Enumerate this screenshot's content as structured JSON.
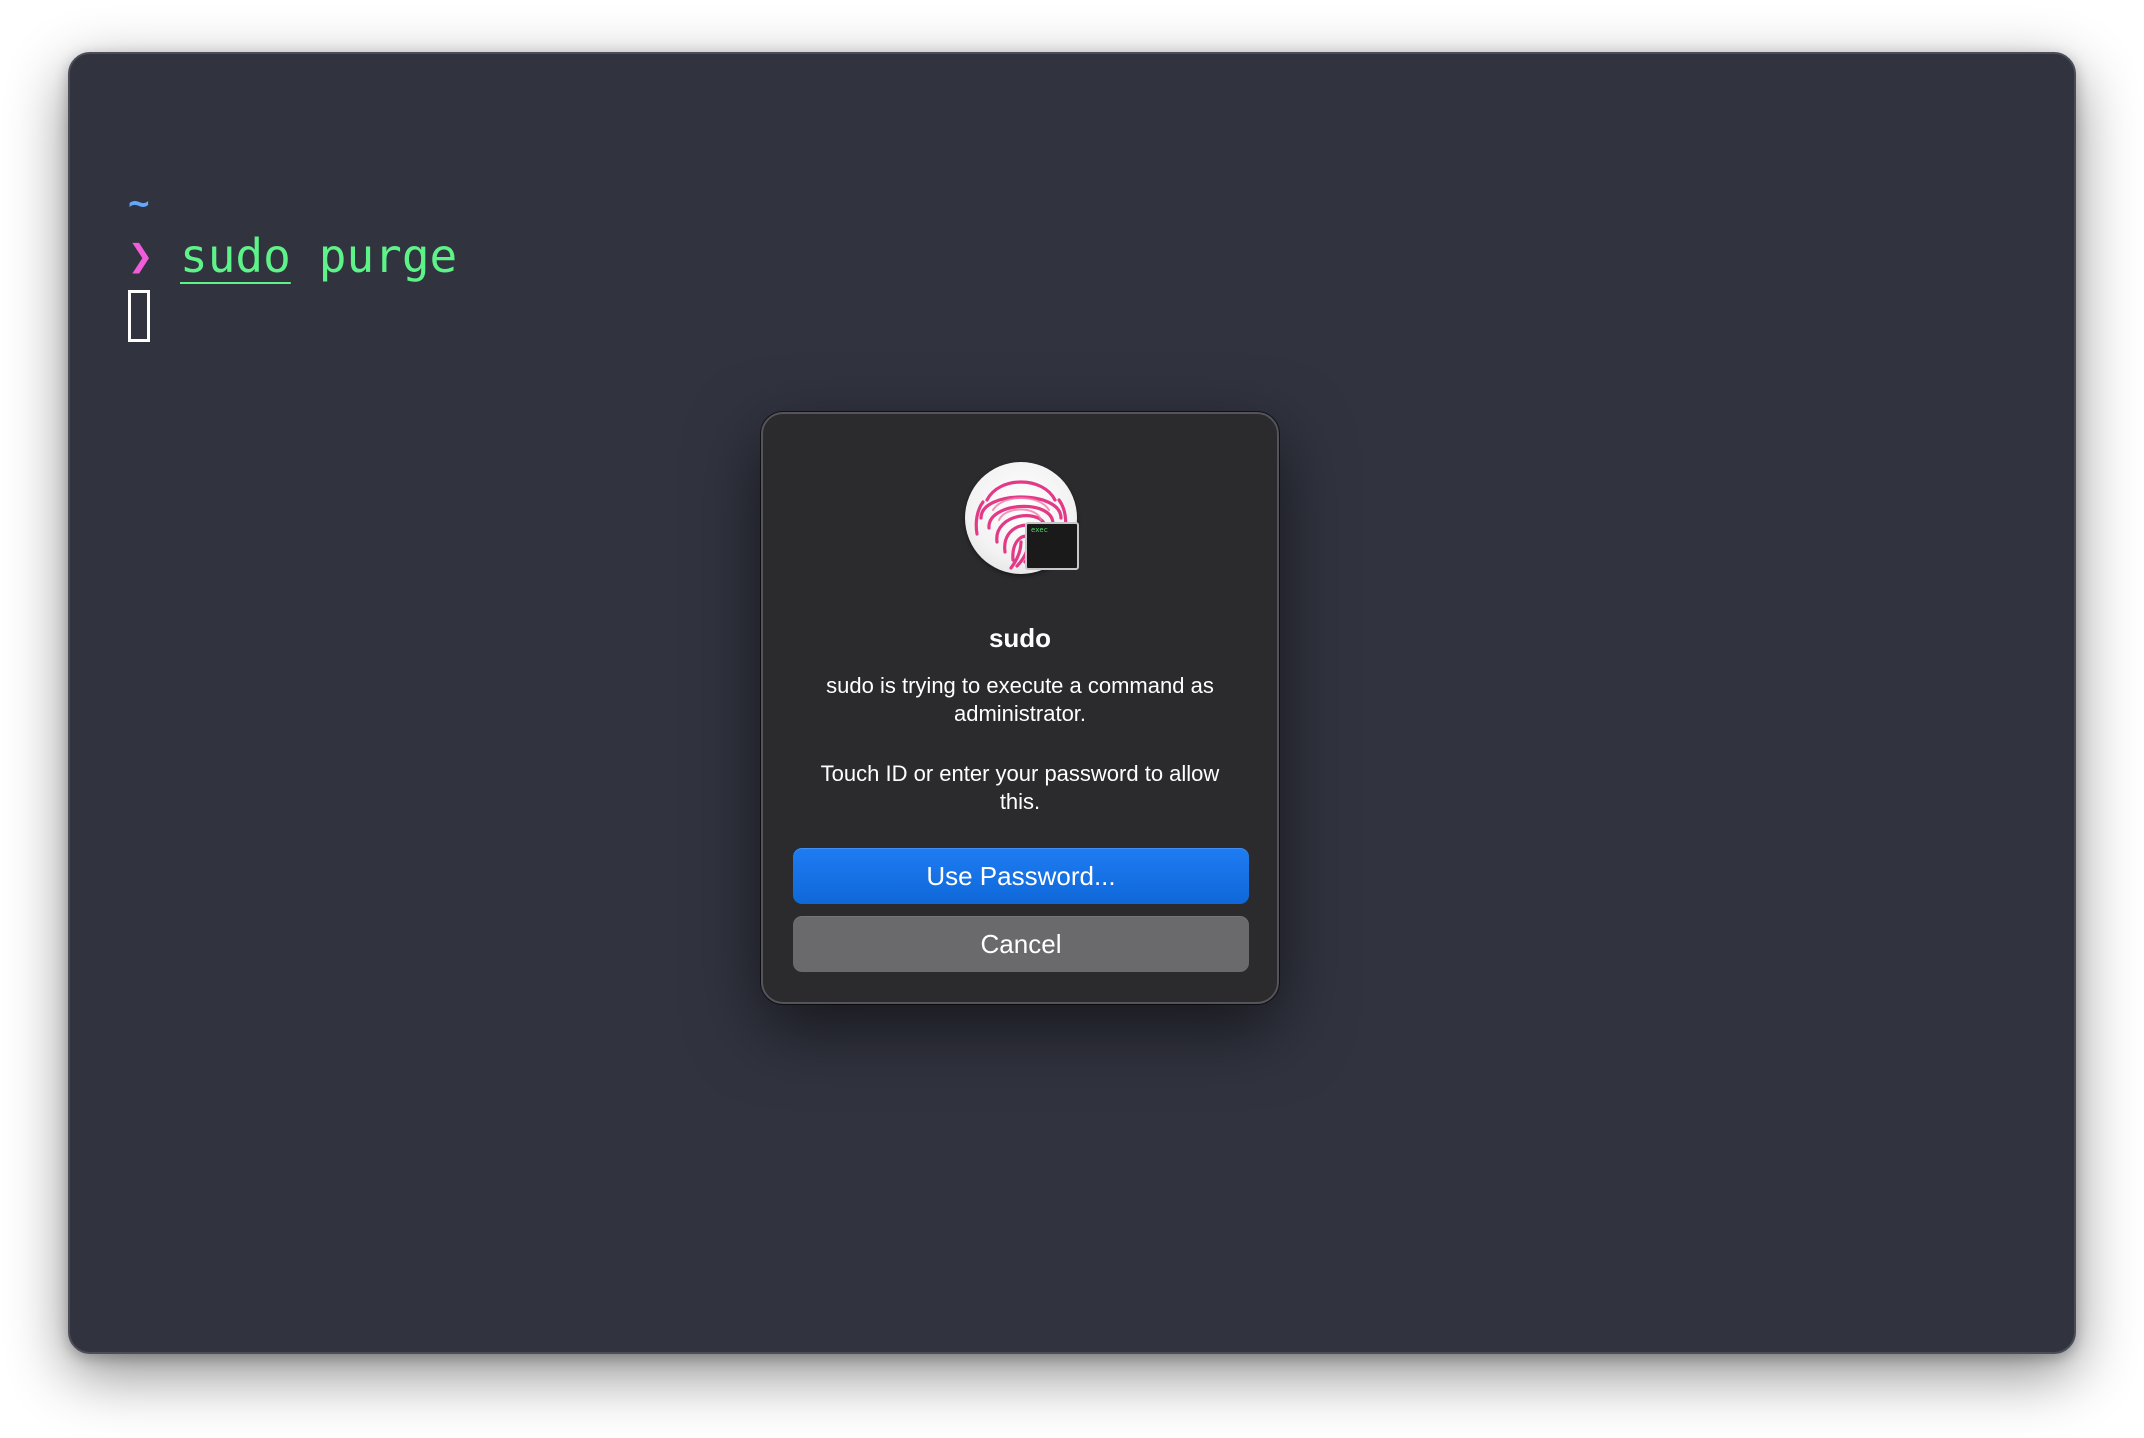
{
  "terminal": {
    "cwd": "~",
    "prompt_symbol": "❯",
    "command_parts": [
      "sudo",
      "purge"
    ]
  },
  "dialog": {
    "icon": "fingerprint-icon",
    "badge_icon": "exec-badge-icon",
    "badge_text": "exec",
    "title": "sudo",
    "message": "sudo is trying to execute a command as administrator.",
    "info": "Touch ID or enter your password to allow this.",
    "primary_button": "Use Password...",
    "secondary_button": "Cancel"
  },
  "colors": {
    "terminal_bg": "#31333f",
    "directory": "#61a6ff",
    "prompt": "#f05cd9",
    "command": "#5df388",
    "dialog_bg": "#2b2b2d",
    "primary_button": "#1a74e8",
    "secondary_button": "#6a6a6c"
  }
}
